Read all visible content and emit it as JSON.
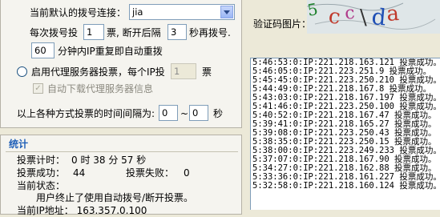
{
  "dial": {
    "connection_label": "当前默认的拨号连接：",
    "connection_value": "jia",
    "per_dial_prefix": "每次拨号投",
    "per_dial_value": "1",
    "per_dial_mid": "票, 断开后隔",
    "wait_value": "3",
    "wait_suffix": "秒再拨号.",
    "redial_minutes_value": "60",
    "redial_suffix": "分钟内IP重复即自动重拨"
  },
  "proxy": {
    "enable_label": "启用代理服务器投票，每个IP投",
    "per_ip_value": "1",
    "per_ip_unit": "票",
    "auto_download_label": "自动下载代理服务器信息"
  },
  "interval": {
    "label": "以上各种方式投票的时间间隔为:",
    "from_value": "0",
    "tilde": "~",
    "to_value": "0",
    "unit": "秒"
  },
  "stats": {
    "title": "统计",
    "time_label": "投票计时：",
    "time_value": "0 时 38 分 57 秒",
    "success_label": "投票成功：",
    "success_value": "44",
    "fail_label": "投票失败：",
    "fail_value": "0",
    "status_label": "当前状态：",
    "status_text": "用户终止了使用自动拨号/断开投票。",
    "partial_bottom": "当前IP地址：   163.357.0.100"
  },
  "captcha": {
    "label": "验证码图片：",
    "chars": [
      "5",
      "c",
      "c",
      "\\",
      "d",
      "a"
    ],
    "colors": [
      "#1a7f2a",
      "#c0392b",
      "#b03a8a",
      "#333333",
      "#1f4fb5",
      "#c0392b"
    ]
  },
  "log": {
    "lines": [
      "5:46:53:0:IP:221.218.163.121 投票成功。",
      "5:46:05:0:IP:221.223.251.9 投票成功。",
      "5:45:45:0:IP:221.223.250.210 投票成功。",
      "5:44:49:0:IP:221.218.167.8 投票成功。",
      "5:43:03:0:IP:221.218.167.197 投票成功。",
      "5:41:46:0:IP:221.223.250.100 投票成功。",
      "5:40:52:0:IP:221.218.167.47 投票成功。",
      "5:39:41:0:IP:221.218.165.27 投票成功。",
      "5:39:08:0:IP:221.223.250.43 投票成功。",
      "5:38:35:0:IP:221.223.250.15 投票成功。",
      "5:38:00:0:IP:221.223.249.233 投票成功。",
      "5:37:07:0:IP:221.218.167.90 投票成功。",
      "5:34:27:0:IP:221.218.162.88 投票成功。",
      "5:33:36:0:IP:221.218.161.227 投票成功。",
      "5:32:58:0:IP:221.218.160.124 投票成功。"
    ]
  }
}
